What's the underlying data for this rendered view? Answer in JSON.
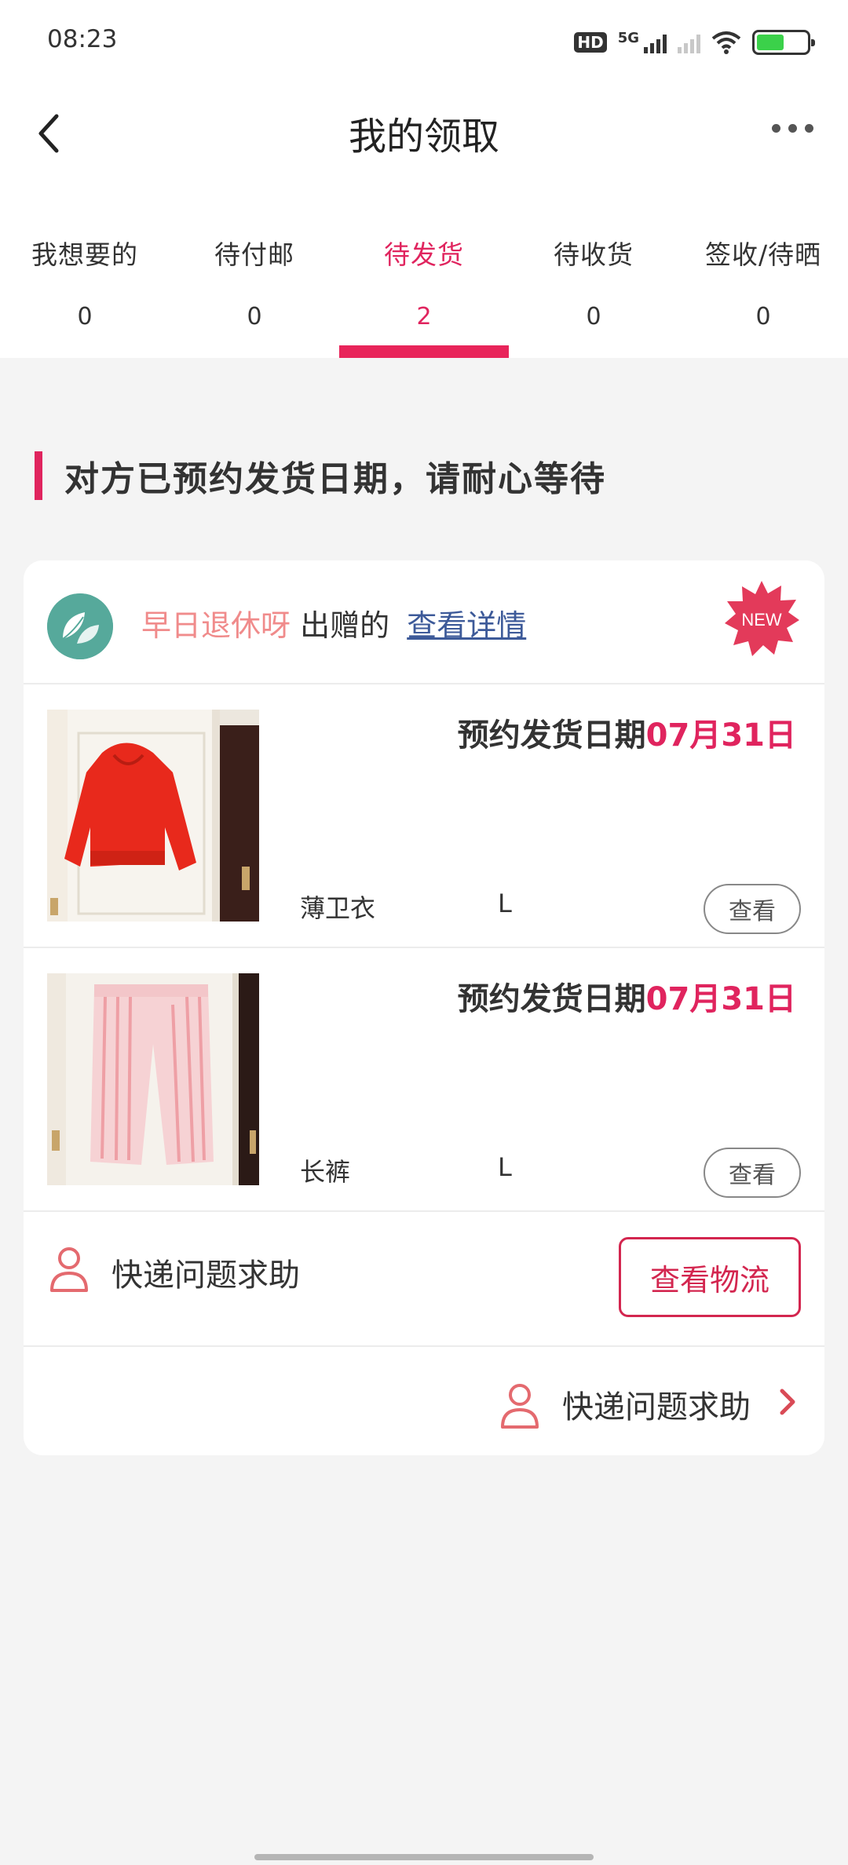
{
  "status_bar": {
    "time": "08:23",
    "hd": "HD",
    "network": "5G",
    "icons": [
      "hd-icon",
      "signal-icon",
      "wifi-icon",
      "battery-icon"
    ]
  },
  "nav": {
    "title": "我的领取",
    "icons": [
      "back-icon",
      "more-icon"
    ]
  },
  "tabs": [
    {
      "label": "我想要的",
      "count": "0"
    },
    {
      "label": "待付邮",
      "count": "0"
    },
    {
      "label": "待发货",
      "count": "2"
    },
    {
      "label": "待收货",
      "count": "0"
    },
    {
      "label": "签收/待晒",
      "count": "0"
    }
  ],
  "active_tab_index": 2,
  "section_heading": "对方已预约发货日期，请耐心等待",
  "card": {
    "giver_name": "早日退休呀",
    "giver_suffix": "出赠的",
    "detail_link": "查看详情",
    "badge": "NEW",
    "items": [
      {
        "date_label": "预约发货日期",
        "date": "07月31日",
        "name": "薄卫衣",
        "size": "L",
        "view_label": "查看"
      },
      {
        "date_label": "预约发货日期",
        "date": "07月31日",
        "name": "长裤",
        "size": "L",
        "view_label": "查看"
      }
    ],
    "help_label": "快递问题求助",
    "logistics_button": "查看物流",
    "footer_help_label": "快递问题求助"
  },
  "colors": {
    "accent": "#e0245e",
    "link": "#3d5a99",
    "giver_name": "#f08b8b",
    "background": "#f4f4f4"
  }
}
